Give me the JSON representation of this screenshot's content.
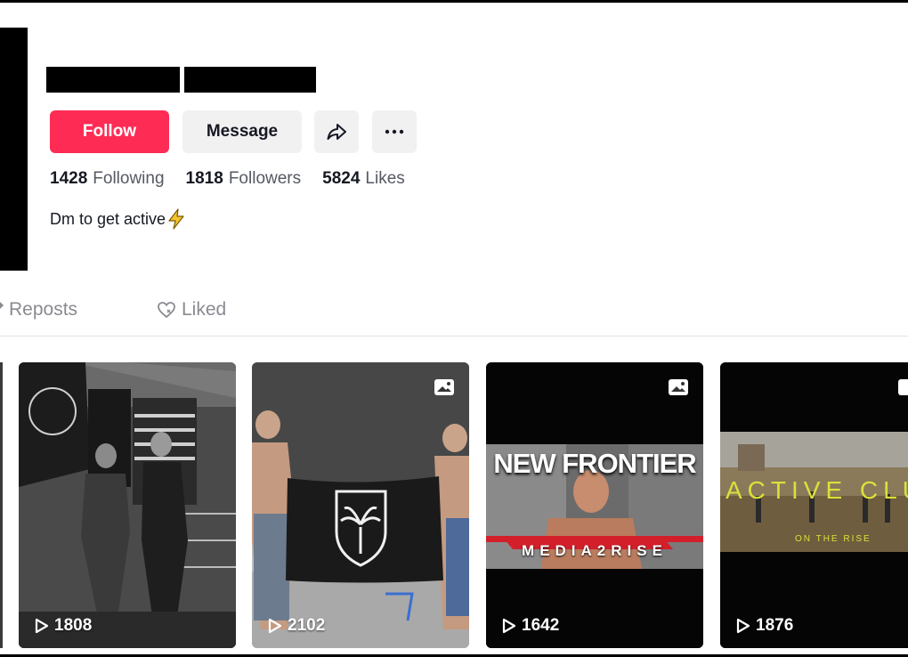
{
  "profile": {
    "buttons": {
      "follow": "Follow",
      "message": "Message"
    },
    "stats": [
      {
        "value": "1428",
        "label": "Following"
      },
      {
        "value": "1818",
        "label": "Followers"
      },
      {
        "value": "5824",
        "label": "Likes"
      }
    ],
    "bio": "Dm to get active"
  },
  "tabs": {
    "reposts": "Reposts",
    "liked": "Liked"
  },
  "videos": [
    {
      "views": "1808"
    },
    {
      "views": "2102"
    },
    {
      "views": "1642",
      "overlay_title": "NEW FRONTIER",
      "overlay_subtitle": "MEDIA2RISE"
    },
    {
      "views": "1876",
      "overlay_title": "ACTIVE CLU",
      "overlay_subtitle": "ON THE RISE"
    }
  ],
  "colors": {
    "follow_bg": "#fe2c55",
    "secondary_btn_bg": "#f1f1f2",
    "text_primary": "#161823",
    "text_secondary": "#8a8b91"
  },
  "icons": {
    "share": "share-arrow-icon",
    "more": "ellipsis-icon",
    "liked": "heart-icon",
    "bolt": "lightning-bolt-icon",
    "play": "play-icon",
    "photo": "photo-mode-icon"
  }
}
